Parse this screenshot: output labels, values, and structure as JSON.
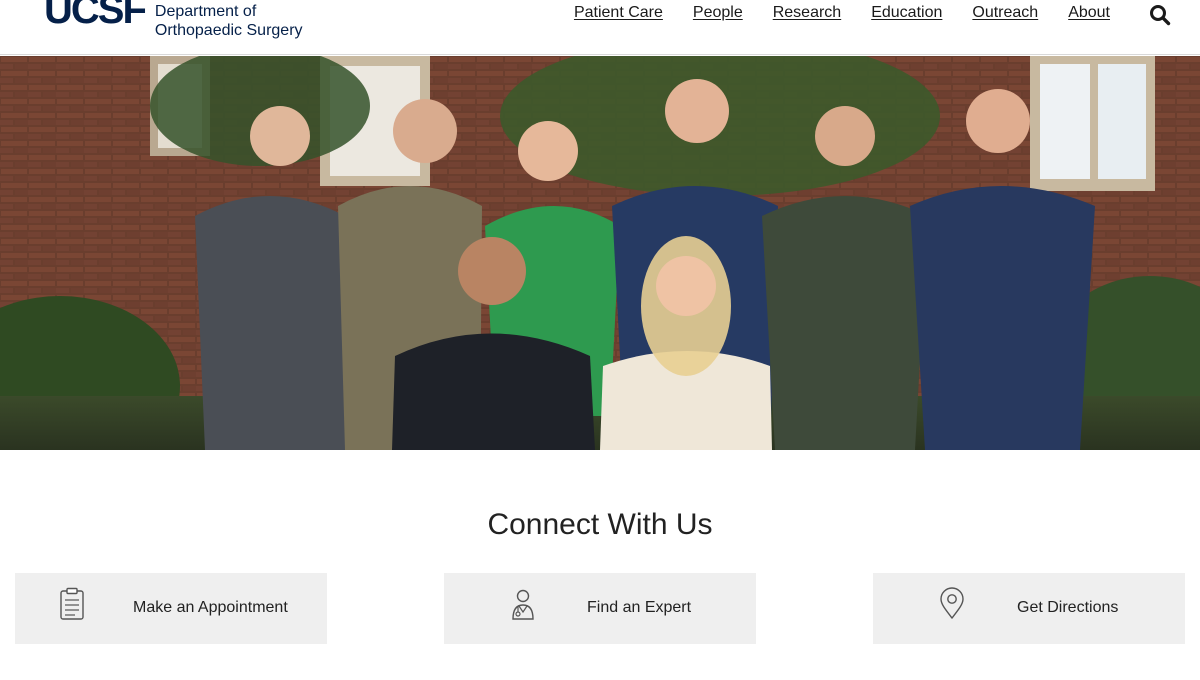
{
  "header": {
    "logo_mark": "UCSF",
    "logo_line1": "Department of",
    "logo_line2": "Orthopaedic Surgery",
    "nav": [
      "Patient Care",
      "People",
      "Research",
      "Education",
      "Outreach",
      "About"
    ],
    "search_icon": "search-icon"
  },
  "hero": {
    "image": "group-photo-of-faculty"
  },
  "connect": {
    "title": "Connect With Us",
    "cards": [
      {
        "label": "Make an Appointment",
        "icon": "clipboard-icon"
      },
      {
        "label": "Find an Expert",
        "icon": "doctor-icon"
      },
      {
        "label": "Get Directions",
        "icon": "map-pin-icon"
      }
    ]
  },
  "colors": {
    "brand_navy": "#052049",
    "card_bg": "#efefef"
  }
}
